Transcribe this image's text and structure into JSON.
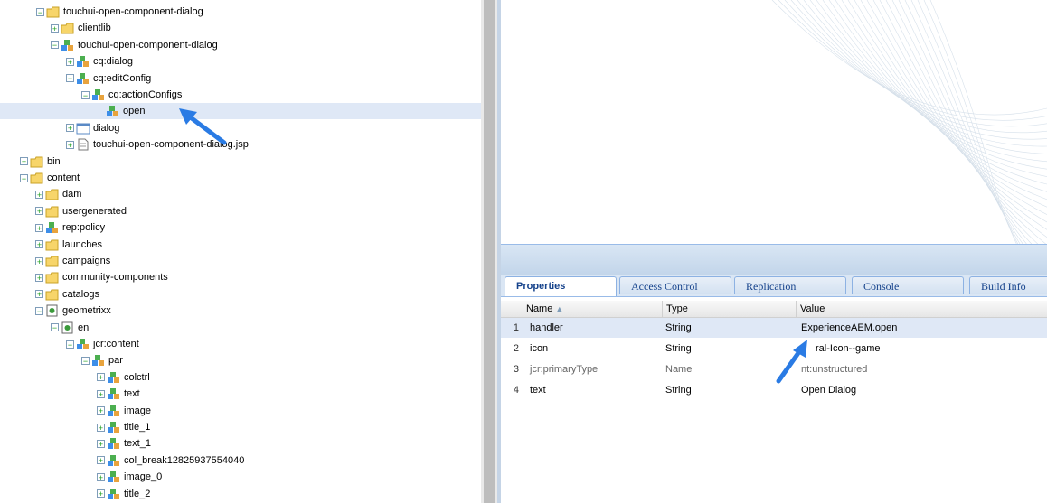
{
  "tree": {
    "nodes": [
      {
        "label": "touchui-open-component-dialog",
        "icon": "folder-icon",
        "expander": "minus"
      },
      {
        "label": "clientlib",
        "icon": "folder-icon",
        "expander": "plus"
      },
      {
        "label": "touchui-open-component-dialog",
        "icon": "component-icon",
        "expander": "minus"
      },
      {
        "label": "cq:dialog",
        "icon": "component-icon",
        "expander": "plus"
      },
      {
        "label": "cq:editConfig",
        "icon": "component-icon",
        "expander": "minus"
      },
      {
        "label": "cq:actionConfigs",
        "icon": "component-icon",
        "expander": "minus"
      },
      {
        "label": "open",
        "icon": "component-icon",
        "expander": "none"
      },
      {
        "label": "dialog",
        "icon": "dialog-icon",
        "expander": "plus"
      },
      {
        "label": "touchui-open-component-dialog.jsp",
        "icon": "file-icon",
        "expander": "plus"
      },
      {
        "label": "bin",
        "icon": "folder-icon",
        "expander": "plus"
      },
      {
        "label": "content",
        "icon": "folder-icon",
        "expander": "minus"
      },
      {
        "label": "dam",
        "icon": "folder-icon",
        "expander": "plus"
      },
      {
        "label": "usergenerated",
        "icon": "folder-icon",
        "expander": "plus"
      },
      {
        "label": "rep:policy",
        "icon": "component-icon",
        "expander": "plus"
      },
      {
        "label": "launches",
        "icon": "folder-icon",
        "expander": "plus"
      },
      {
        "label": "campaigns",
        "icon": "folder-icon",
        "expander": "plus"
      },
      {
        "label": "community-components",
        "icon": "folder-icon",
        "expander": "plus"
      },
      {
        "label": "catalogs",
        "icon": "folder-icon",
        "expander": "plus"
      },
      {
        "label": "geometrixx",
        "icon": "page-icon",
        "expander": "minus"
      },
      {
        "label": "en",
        "icon": "page-icon",
        "expander": "minus"
      },
      {
        "label": "jcr:content",
        "icon": "component-icon",
        "expander": "minus"
      },
      {
        "label": "par",
        "icon": "component-icon",
        "expander": "minus"
      },
      {
        "label": "colctrl",
        "icon": "component-icon",
        "expander": "plus"
      },
      {
        "label": "text",
        "icon": "component-icon",
        "expander": "plus"
      },
      {
        "label": "image",
        "icon": "component-icon",
        "expander": "plus"
      },
      {
        "label": "title_1",
        "icon": "component-icon",
        "expander": "plus"
      },
      {
        "label": "text_1",
        "icon": "component-icon",
        "expander": "plus"
      },
      {
        "label": "col_break12825937554040",
        "icon": "component-icon",
        "expander": "plus"
      },
      {
        "label": "image_0",
        "icon": "component-icon",
        "expander": "plus"
      },
      {
        "label": "title_2",
        "icon": "component-icon",
        "expander": "plus"
      }
    ]
  },
  "tabs": [
    "Properties",
    "Access Control",
    "Replication",
    "Console",
    "Build Info"
  ],
  "grid": {
    "columns": [
      "Name",
      "Type",
      "Value"
    ],
    "rows": [
      {
        "num": "1",
        "name": "handler",
        "type": "String",
        "value": "ExperienceAEM.open"
      },
      {
        "num": "2",
        "name": "icon",
        "type": "String",
        "value": "ral-Icon--game"
      },
      {
        "num": "3",
        "name": "jcr:primaryType",
        "type": "Name",
        "value": "nt:unstructured"
      },
      {
        "num": "4",
        "name": "text",
        "type": "String",
        "value": "Open Dialog"
      }
    ]
  },
  "colors": {
    "accent": "#1a73e8",
    "selection": "#dfe8f6",
    "tab_text": "#15428b"
  }
}
